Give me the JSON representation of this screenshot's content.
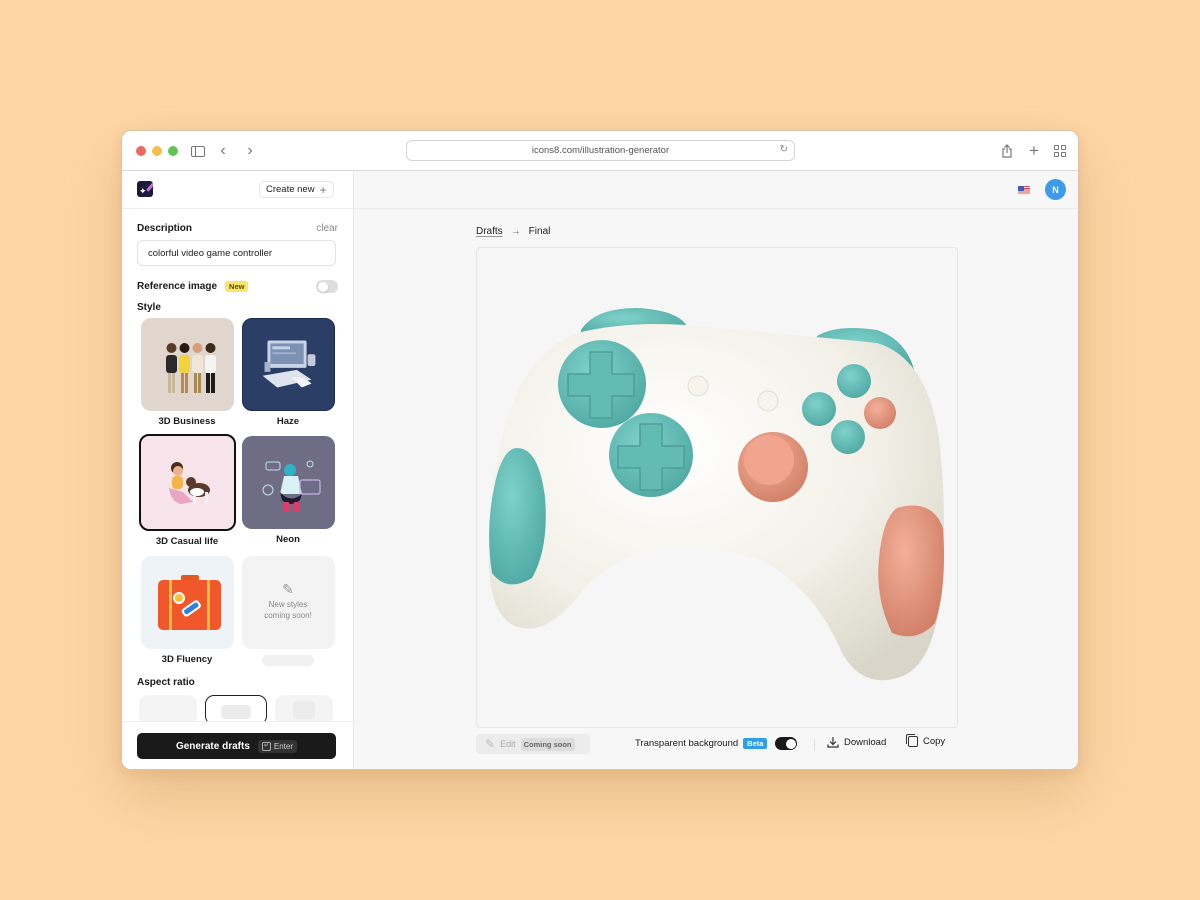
{
  "browser": {
    "url": "icons8.com/illustration-generator",
    "icons": [
      "sidebar-toggle-icon",
      "chevron-left-icon",
      "chevron-right-icon",
      "reload-icon",
      "share-icon",
      "plus-icon",
      "tab-overview-icon"
    ]
  },
  "sidebar": {
    "create_new_label": "Create new",
    "description": {
      "label": "Description",
      "clear_label": "clear",
      "value": "colorful video game controller"
    },
    "reference_image": {
      "label": "Reference image",
      "badge": "New",
      "enabled": false
    },
    "style": {
      "label": "Style",
      "items": [
        {
          "name": "3D Business",
          "selected": false
        },
        {
          "name": "Haze",
          "selected": false
        },
        {
          "name": "3D Casual life",
          "selected": true
        },
        {
          "name": "Neon",
          "selected": false
        },
        {
          "name": "3D Fluency",
          "selected": false
        },
        {
          "name": "",
          "placeholder_text": "New styles coming soon!",
          "selected": false
        }
      ]
    },
    "aspect_ratio": {
      "label": "Aspect ratio",
      "selected_index": 1
    },
    "generate": {
      "label": "Generate drafts",
      "shortcut": "Enter"
    }
  },
  "main": {
    "language_flag": "US",
    "avatar_initial": "N",
    "breadcrumb": {
      "items": [
        "Drafts",
        "Final"
      ],
      "separator": "→"
    },
    "image_subject": "colorful video game controller",
    "colors": {
      "teal": "#6cc3bd",
      "coral": "#e39a82",
      "body": "#f1efe6"
    },
    "actions": {
      "edit_label": "Edit",
      "edit_badge": "Coming soon",
      "transparent_label": "Transparent background",
      "transparent_badge": "Beta",
      "transparent_enabled": true,
      "download_label": "Download",
      "copy_label": "Copy"
    }
  }
}
